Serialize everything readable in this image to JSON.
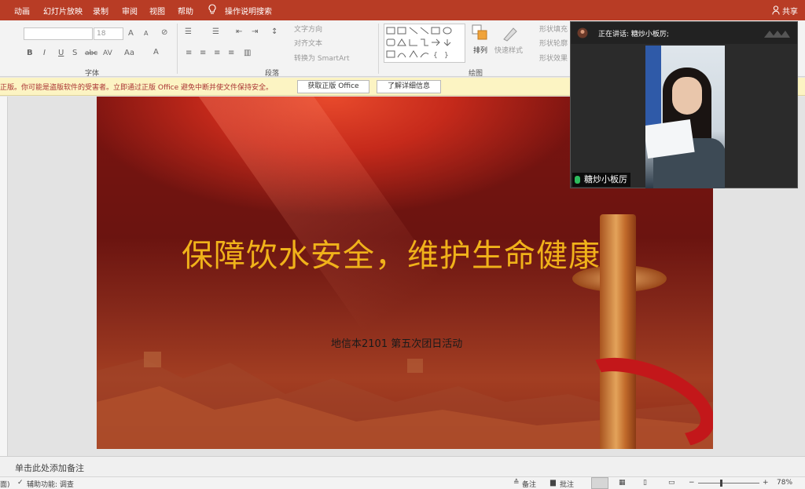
{
  "tabs": [
    "动画",
    "幻灯片放映",
    "录制",
    "审阅",
    "视图",
    "帮助"
  ],
  "tell_me": "操作说明搜索",
  "share": "共享",
  "font": {
    "name_value": "",
    "size_value": "18",
    "group_label": "字体",
    "btn_bold": "B",
    "btn_italic": "I",
    "btn_underline": "U",
    "btn_shadow": "S",
    "btn_strike": "abc",
    "btn_spacing": "AV",
    "btn_case": "Aa",
    "btn_color": "A",
    "btn_grow": "A",
    "btn_shrink": "A"
  },
  "paragraph": {
    "group_label": "段落",
    "text_direction": "文字方向",
    "align_text": "对齐文本",
    "convert_smartart": "转换为 SmartArt"
  },
  "drawing": {
    "group_label": "绘图",
    "arrange": "排列",
    "quick_styles": "快速样式",
    "shape_fill": "形状填充",
    "shape_outline": "形状轮廓",
    "shape_effects": "形状效果"
  },
  "warning": {
    "message": "正版。你可能是盗版软件的受害者。立即通过正版 Office 避免中断并使文件保持安全。",
    "get_genuine": "获取正版 Office",
    "learn_more": "了解详细信息"
  },
  "slide": {
    "title": "保障饮水安全，维护生命健康",
    "subtitle": "地信本2101 第五次团日活动"
  },
  "notes_placeholder": "单击此处添加备注",
  "status": {
    "left_fragment": "面)",
    "accessibility": "辅助功能: 调查",
    "notes_btn": "备注",
    "comments_btn": "批注",
    "zoom_minus": "−",
    "zoom_plus": "+",
    "zoom_level": "78%"
  },
  "meeting": {
    "speaking": "正在讲话: 糖炒小板厉;",
    "participant": "糖炒小板厉"
  }
}
